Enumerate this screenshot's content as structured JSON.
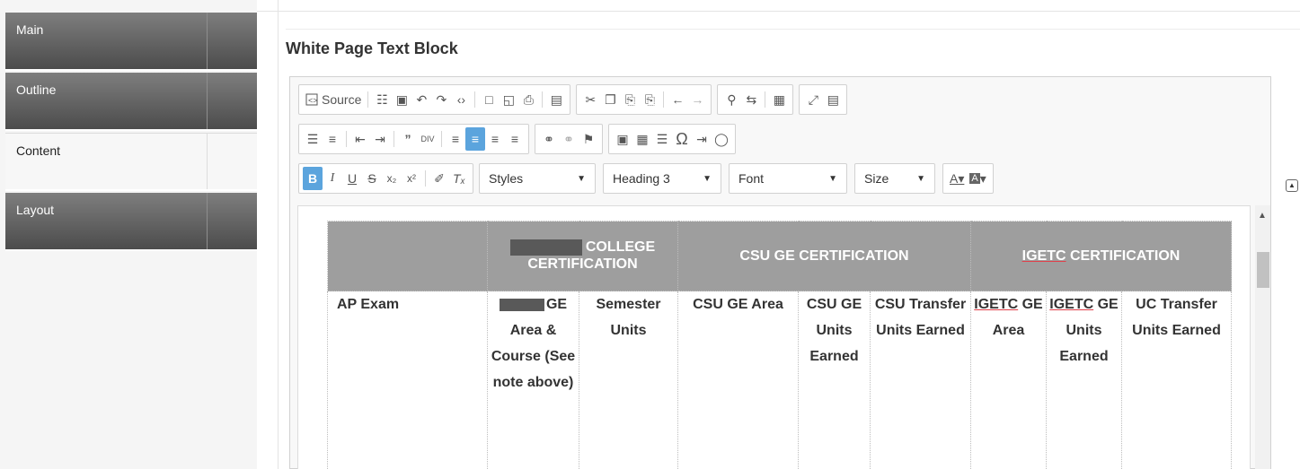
{
  "nav": {
    "items": [
      "Main",
      "Outline",
      "Content",
      "Layout"
    ],
    "active": "Content"
  },
  "page": {
    "title": "White Page Text Block"
  },
  "toolbar": {
    "source_label": "Source",
    "styles": "Styles",
    "heading": "Heading 3",
    "font": "Font",
    "size": "Size"
  },
  "table": {
    "headers": {
      "college": "COLLEGE CERTIFICATION",
      "csu": "CSU GE CERTIFICATION",
      "igetc_a": "IGETC",
      "igetc_b": " CERTIFICATION"
    },
    "row": {
      "ap_exam": "AP Exam",
      "ge_area_course": "GE Area & Course (See note above)",
      "semester_units": "Semester Units",
      "csu_ge_area": "CSU GE Area",
      "csu_ge_units": "CSU GE Units Earned",
      "csu_transfer": "CSU Transfer Units Earned",
      "igetc_ge_area_a": "IGETC",
      "igetc_ge_area_b": " GE Area",
      "igetc_ge_units_a": "IGETC",
      "igetc_ge_units_b": " GE Units Earned",
      "uc_transfer": "UC Transfer Units Earned"
    }
  },
  "colors": {
    "nav_dark": "#5e5e5e",
    "header_gray": "#9e9e9e",
    "active_button": "#5ba4dd"
  }
}
